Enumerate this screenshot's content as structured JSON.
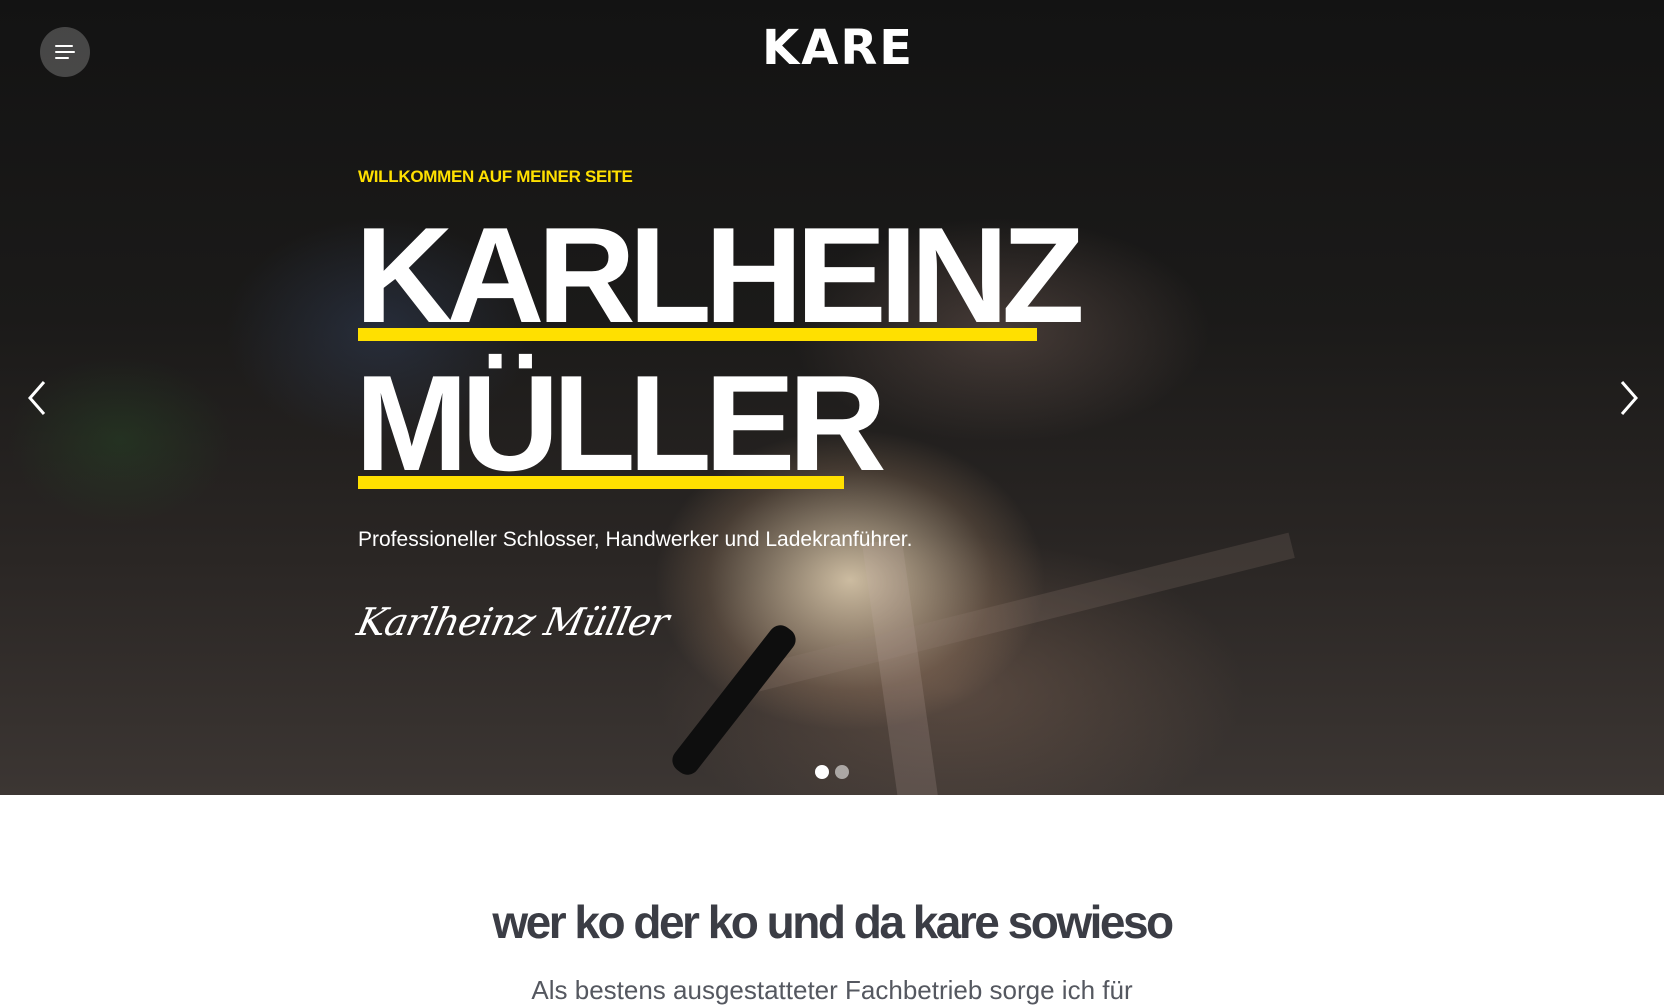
{
  "header": {
    "menu_button_label": "",
    "logo_text": "KARE"
  },
  "hero": {
    "eyebrow": "WILLKOMMEN AUF MEINER SEITE",
    "name_line1": "KARLHEINZ",
    "name_line2": "MÜLLER",
    "tagline": "Professioneller Schlosser, Handwerker und Ladekranführer.",
    "signature": "Karlheinz Müller",
    "slides": {
      "total": 2,
      "active": 1
    }
  },
  "intro": {
    "heading": "wer ko der ko und da kare sowieso",
    "text": "Als bestens ausgestatteter Fachbetrieb sorge ich für"
  },
  "colors": {
    "accent": "#ffe000",
    "heading": "#3b3d45",
    "text": "#555860"
  },
  "icons": {
    "menu": "menu-icon",
    "prev": "chevron-left-icon",
    "next": "chevron-right-icon"
  }
}
